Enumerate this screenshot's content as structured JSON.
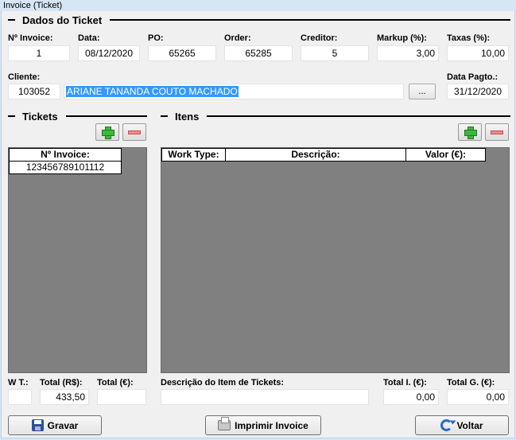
{
  "window": {
    "title": "Invoice (Ticket)"
  },
  "ticket_section": {
    "title": "Dados do Ticket"
  },
  "fields": {
    "invoice_no": {
      "label": "Nº Invoice:",
      "value": "1"
    },
    "date": {
      "label": "Data:",
      "value": "08/12/2020"
    },
    "po": {
      "label": "PO:",
      "value": "65265"
    },
    "order": {
      "label": "Order:",
      "value": "65285"
    },
    "creditor": {
      "label": "Creditor:",
      "value": "5"
    },
    "markup": {
      "label": "Markup (%):",
      "value": "3,00"
    },
    "taxes": {
      "label": "Taxas (%):",
      "value": "10,00"
    },
    "client": {
      "label": "Cliente:",
      "code": "103052",
      "name": "ARIANE TANANDA COUTO MACHADO"
    },
    "lookup_button": {
      "label": "..."
    },
    "payment_date": {
      "label": "Data Pagto.:",
      "value": "31/12/2020"
    }
  },
  "tickets": {
    "title": "Tickets",
    "columns": [
      "Nº Invoice:"
    ],
    "rows": [
      [
        "123456789101112"
      ]
    ]
  },
  "items": {
    "title": "Itens",
    "columns": [
      "Work Type:",
      "Descrição:",
      "Valor (€):"
    ],
    "rows": []
  },
  "footer": {
    "wt": {
      "label": "W T.:",
      "value": ""
    },
    "total_brl": {
      "label": "Total (R$):",
      "value": "433,50"
    },
    "total_eur": {
      "label": "Total (€):",
      "value": ""
    },
    "item_desc": {
      "label": "Descrição do Item de Tickets:",
      "value": ""
    },
    "total_i": {
      "label": "Total I. (€):",
      "value": "0,00"
    },
    "total_g": {
      "label": "Total G. (€):",
      "value": "0,00"
    }
  },
  "buttons": {
    "save": "Gravar",
    "print": "Imprimir Invoice",
    "back": "Voltar"
  }
}
